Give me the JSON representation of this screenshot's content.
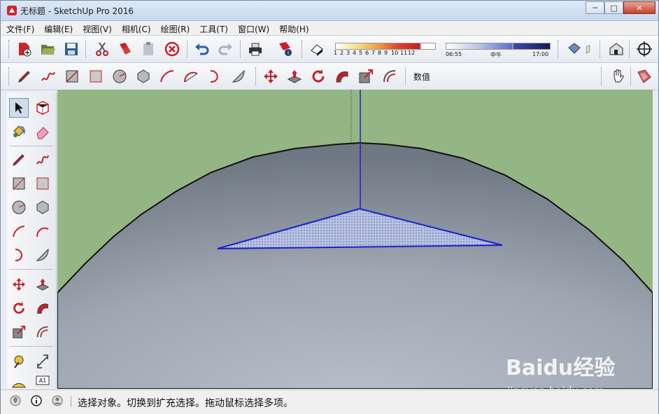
{
  "window": {
    "title": "无标题 - SketchUp Pro 2016",
    "minimize": "─",
    "maximize": "□",
    "close": "✕"
  },
  "menu": [
    "文件(F)",
    "编辑(E)",
    "视图(V)",
    "相机(C)",
    "绘图(R)",
    "工具(T)",
    "窗口(W)",
    "帮助(H)"
  ],
  "toolbar1": {
    "shadow_months": [
      "1",
      "2",
      "3",
      "4",
      "5",
      "6",
      "7",
      "8",
      "9",
      "10",
      "11",
      "12"
    ],
    "time_start": "06:55",
    "time_mid": "中午",
    "time_end": "17:00"
  },
  "toolbar2": {
    "measurements_label": "数值"
  },
  "status": {
    "message": "选择对象。切换到扩充选择。拖动鼠标选择多项。"
  },
  "watermark": {
    "brand": "Baidu经验",
    "url": "jingyan.baidu.com"
  },
  "colors": {
    "accent_red": "#c8202a",
    "viewport_ground": "#94b684",
    "selection_blue": "#1a22c8"
  }
}
